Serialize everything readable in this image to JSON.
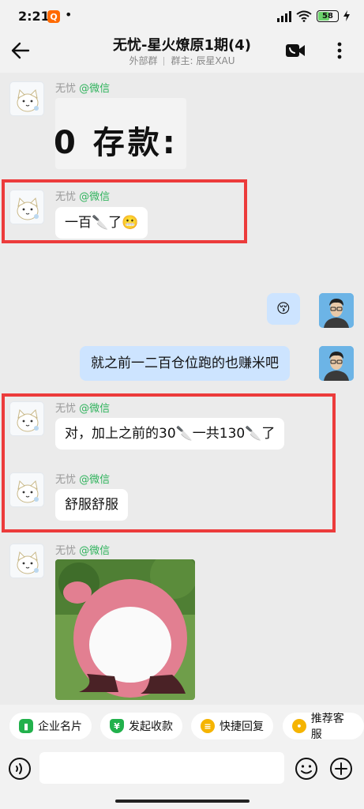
{
  "status_bar": {
    "time": "2:21",
    "app_icon": "Q",
    "dot": "•",
    "battery": "58",
    "icons": [
      "hd-signal-icon",
      "wifi-icon",
      "battery-icon",
      "charging-icon"
    ]
  },
  "header": {
    "title": "无忧-星火燎原1期(4)",
    "subtitle_type": "外部群",
    "subtitle_owner": "群主: 辰星XAU",
    "icons": [
      "back-arrow-icon",
      "video-call-icon",
      "more-vertical-icon"
    ]
  },
  "messages": [
    {
      "sender": "无忧",
      "tag": "@微信",
      "type": "image",
      "image_text": "0 存款:"
    },
    {
      "sender": "无忧",
      "tag": "@微信",
      "type": "text",
      "text": "一百🔪了😬"
    },
    {
      "sender": "self",
      "type": "emoji",
      "emoji": "😚"
    },
    {
      "sender": "self",
      "type": "text",
      "text": "就之前一二百仓位跑的也赚米吧"
    },
    {
      "sender": "无忧",
      "tag": "@微信",
      "type": "text",
      "text": "对，加上之前的30🔪一共130🔪了"
    },
    {
      "sender": "无忧",
      "tag": "@微信",
      "type": "text",
      "text": "舒服舒服"
    },
    {
      "sender": "无忧",
      "tag": "@微信",
      "type": "sticker",
      "description": "pink-bear-sticker"
    }
  ],
  "quick_actions": [
    {
      "label": "企业名片",
      "icon": "business-card-icon",
      "color": "#22b14c"
    },
    {
      "label": "发起收款",
      "icon": "yen-shield-icon",
      "color": "#22b14c"
    },
    {
      "label": "快捷回复",
      "icon": "quick-reply-icon",
      "color": "#f5b400"
    },
    {
      "label": "推荐客服",
      "icon": "recommend-service-icon",
      "color": "#f5b400"
    }
  ],
  "input": {
    "placeholder": "",
    "icons": [
      "voice-icon",
      "emoji-icon",
      "plus-icon"
    ]
  },
  "colors": {
    "background": "#ebebeb",
    "self_bubble": "#cde4ff",
    "tag_green": "#2fb35c",
    "highlight_red": "#ec3b3b"
  }
}
